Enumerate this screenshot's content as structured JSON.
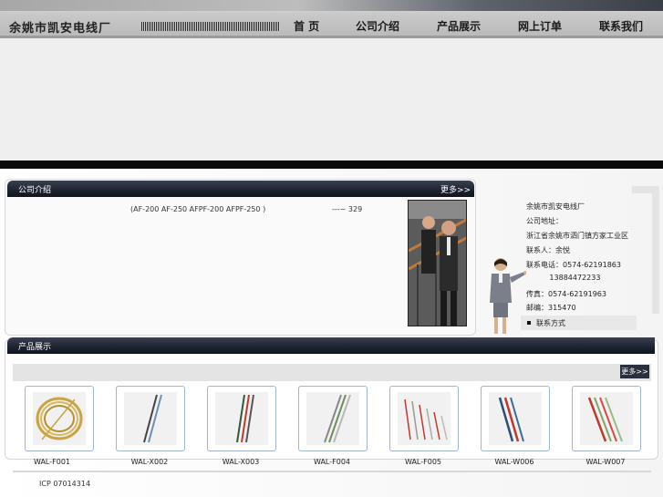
{
  "header": {
    "brand": "余姚市凯安电线厂",
    "nav": [
      "首 页",
      "公司介绍",
      "产品展示",
      "网上订单",
      "联系我们"
    ]
  },
  "about": {
    "title": "公司介绍",
    "more": "更多>>",
    "text": "(AF-200 AF-250 AFPF-200 AFPF-250 )",
    "extra": "---~  329"
  },
  "contact": {
    "lines": [
      "余姚市凯安电线厂",
      "公司地址：",
      "浙江省余姚市泗门镇方家工业区",
      "联系人：余悦",
      "联系电话：0574-62191863",
      "          13884472233",
      "传真：0574-62191963",
      "邮编：315470"
    ],
    "button": "联系方式"
  },
  "products": {
    "title": "产品展示",
    "more": "更多>>",
    "items": [
      {
        "name": "WAL-F001"
      },
      {
        "name": "WAL-X002"
      },
      {
        "name": "WAL-X003"
      },
      {
        "name": "WAL-F004"
      },
      {
        "name": "WAL-F005"
      },
      {
        "name": "WAL-W006"
      },
      {
        "name": "WAL-W007"
      }
    ]
  },
  "footer": {
    "icp": "ICP 07014314"
  }
}
